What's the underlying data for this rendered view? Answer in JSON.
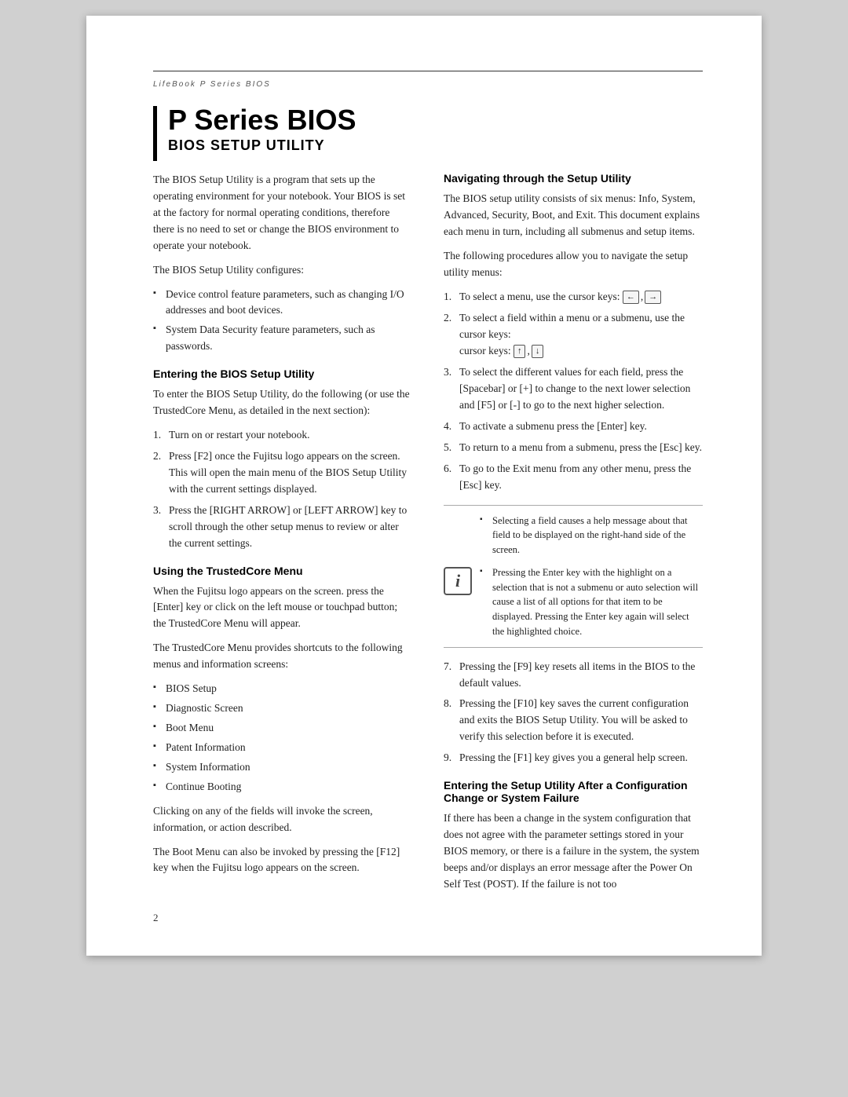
{
  "header": {
    "label": "LifeBook P Series BIOS"
  },
  "title": {
    "main": "P Series BIOS",
    "sub": "BIOS SETUP UTILITY"
  },
  "intro": {
    "p1": "The BIOS Setup Utility is a program that sets up the operating environment for your notebook. Your BIOS is set at the factory for normal operating conditions, therefore there is no need to set or change the BIOS environment to operate your notebook.",
    "p2": "The BIOS Setup Utility configures:",
    "bullets": [
      "Device control feature parameters, such as changing I/O addresses and boot devices.",
      "System Data Security feature parameters, such as passwords."
    ]
  },
  "entering_bios": {
    "heading": "Entering the BIOS Setup Utility",
    "p1": "To enter the BIOS Setup Utility, do the following (or use the TrustedCore Menu, as detailed in the next section):",
    "steps": [
      "Turn on or restart your notebook.",
      "Press [F2] once the Fujitsu logo appears on the screen. This will open the main menu of the BIOS Setup Utility with the current settings displayed.",
      "Press the [RIGHT ARROW] or [LEFT ARROW] key to scroll through the other setup menus to review or alter the current settings."
    ]
  },
  "trustedcore": {
    "heading": "Using the TrustedCore Menu",
    "p1": "When the Fujitsu logo appears on the screen. press the [Enter] key or click on the left mouse or touchpad button; the TrustedCore Menu will appear.",
    "p2": "The TrustedCore Menu provides shortcuts to the following menus and information screens:",
    "bullets": [
      "BIOS Setup",
      "Diagnostic Screen",
      "Boot Menu",
      "Patent Information",
      "System Information",
      "Continue Booting"
    ],
    "p3": "Clicking on any of the fields will invoke the screen, information, or action described.",
    "p4": "The Boot Menu can also be invoked by pressing the [F12] key when the Fujitsu logo appears on the screen."
  },
  "navigating": {
    "heading": "Navigating through the Setup Utility",
    "p1": "The BIOS setup utility consists of six menus: Info, System, Advanced, Security, Boot, and Exit. This document explains each menu in turn, including all submenus and setup items.",
    "p2": "The following procedures allow you to navigate the setup utility menus:",
    "steps": [
      "To select a menu, use the cursor keys:",
      "To select a field within a menu or a submenu, use the cursor keys:",
      "To select the different values for each field, press the [Spacebar] or [+] to change to the next lower selection and [F5] or [-] to go to the next higher selection.",
      "To activate a submenu press the [Enter] key.",
      "To return to a menu from a submenu, press the [Esc] key.",
      "To go to the Exit menu from any other menu, press the [Esc] key."
    ],
    "info_notes": [
      "Selecting a field causes a help message about that field to be displayed on the right-hand side of the screen.",
      "Pressing the Enter key with the highlight on a selection that is not a submenu or auto selection will cause a list of all options for that item to be displayed. Pressing the Enter key again will select the highlighted choice."
    ],
    "steps_continued": [
      "Pressing the [F9] key resets all items in the BIOS to the default values.",
      "Pressing the [F10] key saves the current configuration and exits the BIOS Setup Utility. You will be asked to verify this selection before it is executed.",
      "Pressing the [F1] key gives you a general help screen."
    ]
  },
  "entering_setup": {
    "heading": "Entering the Setup Utility After a Configuration Change or System Failure",
    "p1": "If there has been a change in the system configuration that does not agree with the parameter settings stored in your BIOS memory, or there is a failure in the system, the system beeps and/or displays an error message after the Power On Self Test (POST). If the failure is not too"
  },
  "page_number": "2"
}
